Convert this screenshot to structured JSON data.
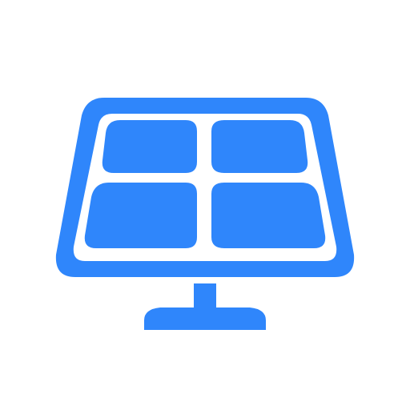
{
  "icon": {
    "name": "solar-panel-icon",
    "color": "#2f86fb",
    "background": "#ffffff"
  }
}
